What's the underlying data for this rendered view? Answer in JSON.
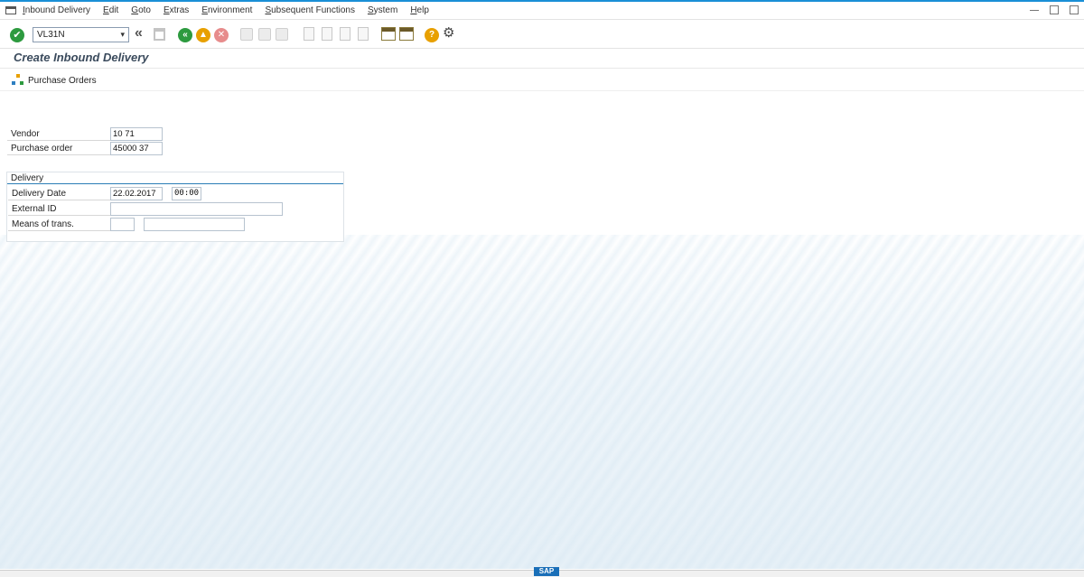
{
  "menubar": {
    "items": [
      "Inbound Delivery",
      "Edit",
      "Goto",
      "Extras",
      "Environment",
      "Subsequent Functions",
      "System",
      "Help"
    ]
  },
  "toolbar": {
    "command_field": "VL31N",
    "icons": [
      "enter-icon",
      "back-icon",
      "exit-icon",
      "cancel-icon",
      "print-icon",
      "find-icon",
      "find-next-icon",
      "first-page-icon",
      "previous-page-icon",
      "next-page-icon",
      "last-page-icon",
      "create-session-icon",
      "shortcut-icon",
      "help-icon",
      "customize-layout-icon"
    ]
  },
  "title": {
    "text": "Create Inbound Delivery"
  },
  "app_toolbar": {
    "purchase_orders_label": "Purchase Orders"
  },
  "form": {
    "vendor_label": "Vendor",
    "vendor_value": "10    71",
    "po_label": "Purchase order",
    "po_value": "45000      37"
  },
  "delivery_group": {
    "title": "Delivery",
    "delivery_date_label": "Delivery Date",
    "delivery_date_value": "22.02.2017",
    "delivery_time_value": "00:00",
    "external_id_label": "External ID",
    "external_id_value": "",
    "means_of_trans_label": "Means of trans.",
    "means_of_trans_type": "",
    "means_of_trans_id": ""
  },
  "status": {
    "logo": "SAP"
  },
  "colors": {
    "accent": "#1a8fd6",
    "ok_green": "#2d9a3f",
    "exit_orange": "#e8a000",
    "cancel_red": "#e78c8c",
    "group_line": "#2b7db6"
  }
}
